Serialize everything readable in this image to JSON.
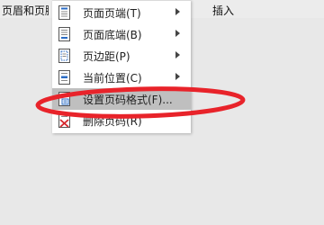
{
  "menubar": {
    "items": [
      {
        "label": "页眉和页脚"
      },
      {
        "label": "插入"
      }
    ]
  },
  "menu": {
    "items": [
      {
        "label": "页面页端(T)",
        "icon": "page-header-icon",
        "submenu": true
      },
      {
        "label": "页面底端(B)",
        "icon": "page-footer-icon",
        "submenu": true
      },
      {
        "label": "页边距(P)",
        "icon": "page-margin-icon",
        "submenu": true
      },
      {
        "label": "当前位置(C)",
        "icon": "current-position-icon",
        "submenu": true
      },
      {
        "label": "设置页码格式(F)...",
        "icon": "page-number-format-icon",
        "submenu": false,
        "highlighted": true
      },
      {
        "label": "删除页码(R)",
        "icon": "delete-page-number-icon",
        "submenu": false
      }
    ]
  },
  "annotation": {
    "color": "#e8232a"
  }
}
